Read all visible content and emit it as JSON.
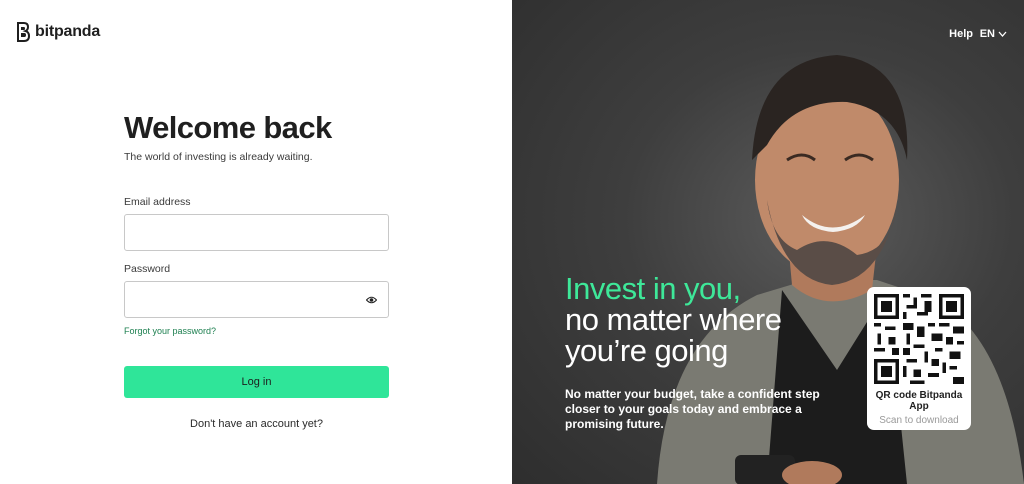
{
  "brand": {
    "name": "bitpanda",
    "logo_icon": "bitpanda-b-icon"
  },
  "login": {
    "title": "Welcome back",
    "subtitle": "The world of investing is already waiting.",
    "email_label": "Email address",
    "email_value": "",
    "password_label": "Password",
    "password_value": "",
    "forgot_link": "Forgot your password?",
    "login_button": "Log in",
    "signup_text": "Don't have an account yet?"
  },
  "topbar": {
    "help": "Help",
    "language": "EN"
  },
  "promo": {
    "headline_green": "Invest in you,",
    "headline_line2": "no matter where",
    "headline_line3": "you’re going",
    "body": "No matter your budget, take a confident step closer to your goals today and embrace a promising future."
  },
  "qr": {
    "title": "QR code Bitpanda App",
    "subtitle": "Scan to download"
  },
  "colors": {
    "accent": "#2fe599",
    "accent_text": "#3ee899",
    "link": "#1c7f4f",
    "panel_bg": "#3e3e3e"
  }
}
